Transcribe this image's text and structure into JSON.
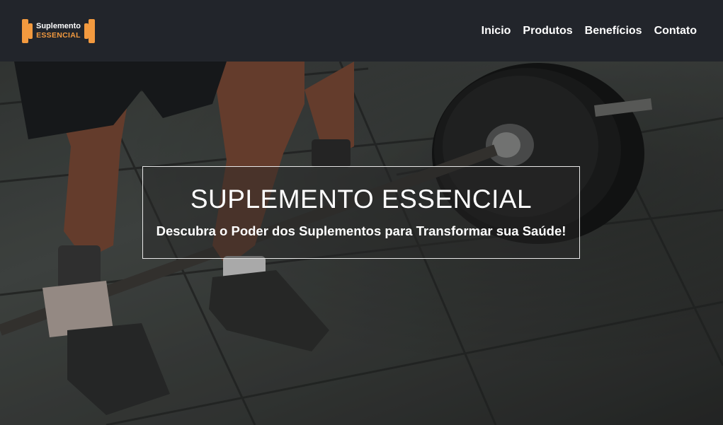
{
  "logo": {
    "line1": "Suplemento",
    "line2": "ESSENCIAL",
    "accent": "#f39a3f"
  },
  "nav": {
    "items": [
      "Inicio",
      "Produtos",
      "Benefícios",
      "Contato"
    ]
  },
  "hero": {
    "title": "SUPLEMENTO ESSENCIAL",
    "subtitle": "Descubra o Poder dos Suplementos para Transformar sua Saúde!"
  },
  "colors": {
    "navbar_bg": "#22252b",
    "accent": "#f39a3f",
    "text": "#ffffff"
  }
}
